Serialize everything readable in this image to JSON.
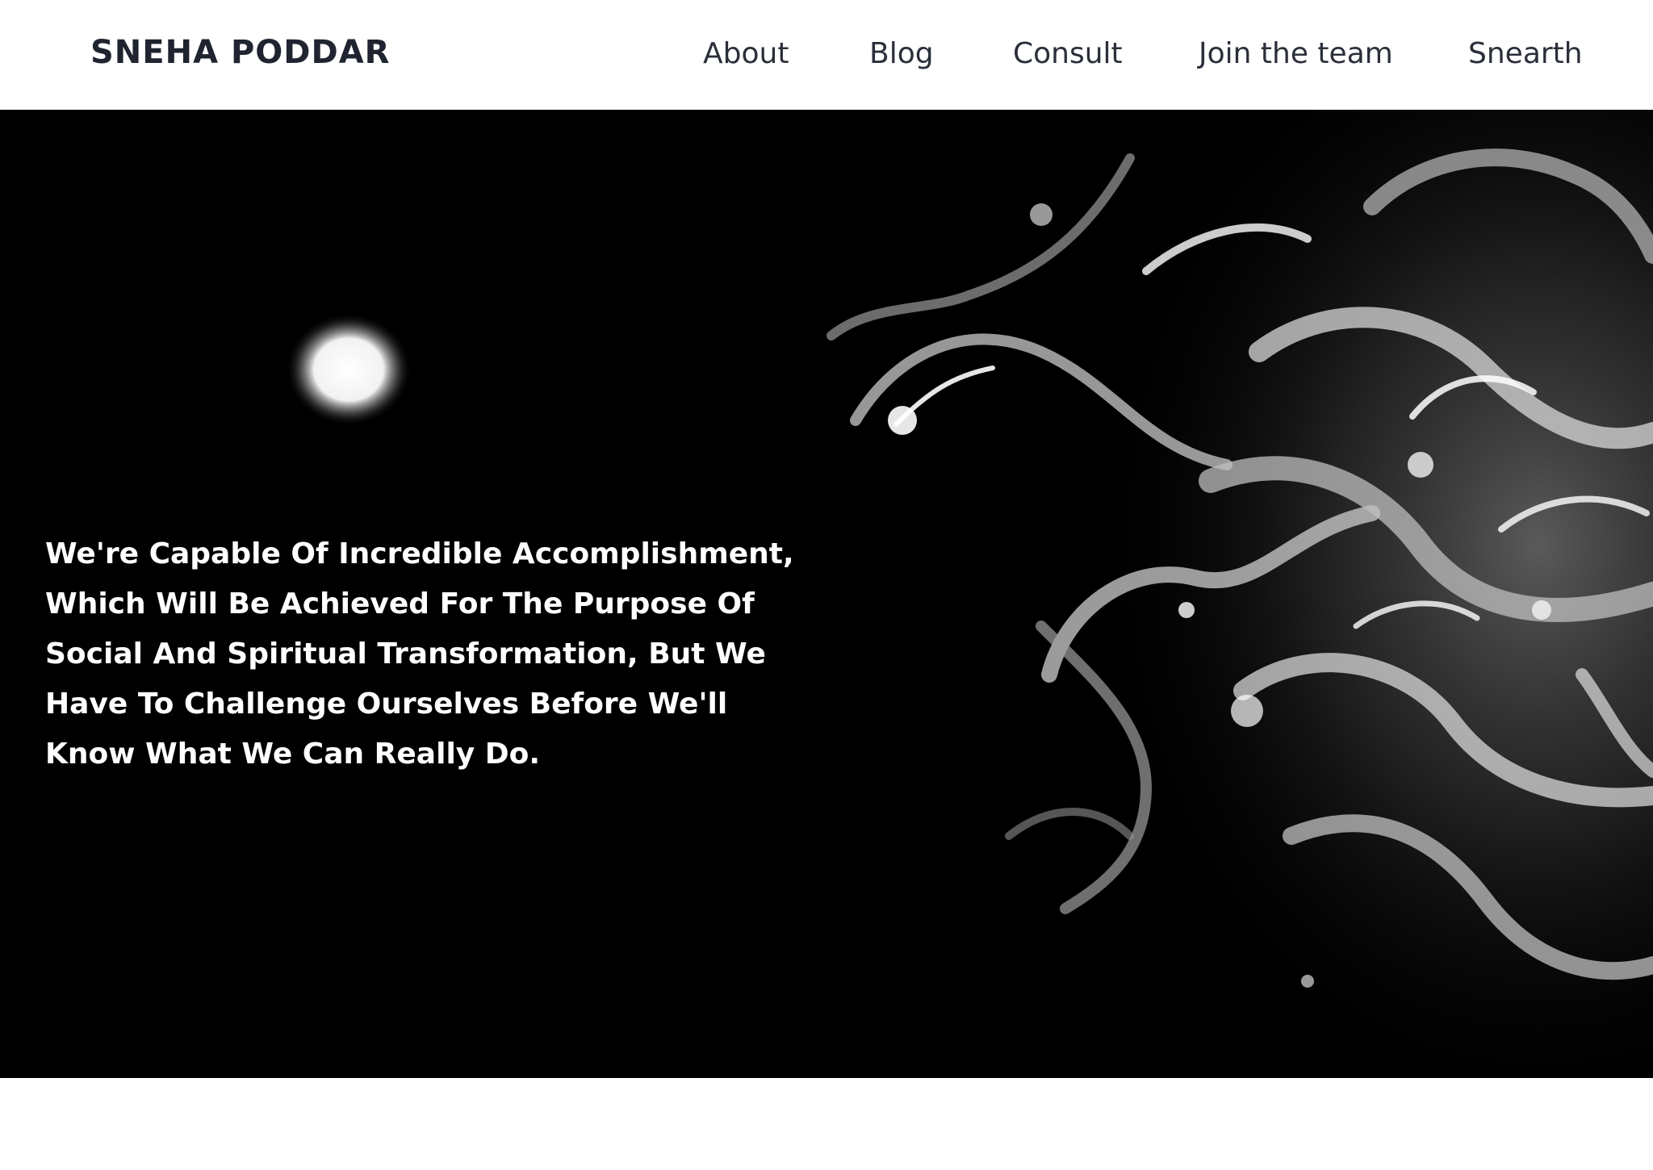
{
  "brand": {
    "name": "SNEHA PODDAR"
  },
  "nav": {
    "items": [
      {
        "label": "About"
      },
      {
        "label": "Blog"
      },
      {
        "label": "Consult"
      },
      {
        "label": "Join the team"
      },
      {
        "label": "Snearth"
      }
    ]
  },
  "hero": {
    "quote": "We're Capable Of Incredible Accomplishment, Which Will Be Achieved For The Purpose Of Social And Spiritual Transformation, But We Have To Challenge Ourselves Before We'll Know What We Can Really Do.",
    "image_description_icon": "glass-sculpture-image"
  },
  "colors": {
    "nav_text": "#2a2f3a",
    "brand_text": "#1f2430",
    "hero_bg": "#000000",
    "hero_text": "#ffffff"
  }
}
